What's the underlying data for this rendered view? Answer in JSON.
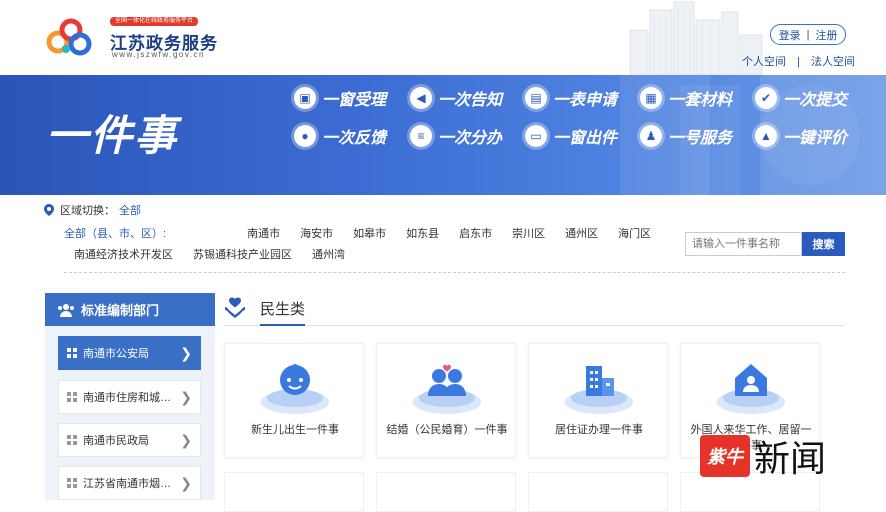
{
  "header": {
    "badge": "全国一体化在线政务服务平台",
    "title": "江苏政务服务",
    "url": "www.jszwfw.gov.cn",
    "login": "登录",
    "auth_sep": "|",
    "register": "注册",
    "personal_space": "个人空间",
    "space_sep": "|",
    "corporate_space": "法人空间"
  },
  "banner": {
    "title": "一件事",
    "features": [
      {
        "label": "一窗受理",
        "icon": "window-icon"
      },
      {
        "label": "一次告知",
        "icon": "megaphone-icon"
      },
      {
        "label": "一表申请",
        "icon": "form-icon"
      },
      {
        "label": "一套材料",
        "icon": "folder-icon"
      },
      {
        "label": "一次提交",
        "icon": "check-icon"
      },
      {
        "label": "一次反馈",
        "icon": "chat-icon"
      },
      {
        "label": "一次分办",
        "icon": "list-icon"
      },
      {
        "label": "一窗出件",
        "icon": "printer-icon"
      },
      {
        "label": "一号服务",
        "icon": "user-badge-icon"
      },
      {
        "label": "一键评价",
        "icon": "thumbs-up-icon"
      }
    ]
  },
  "region": {
    "label": "区域切换：",
    "current": "全部",
    "all_label": "全部（县、市、区）:",
    "cities": [
      "南通市",
      "海安市",
      "如皋市",
      "如东县",
      "启东市",
      "崇川区",
      "通州区",
      "海门区",
      "南通经济技术开发区",
      "苏锡通科技产业园区",
      "通州湾"
    ]
  },
  "search": {
    "placeholder": "请输入一件事名称",
    "button": "搜索"
  },
  "sidebar": {
    "title": "标准编制部门",
    "items": [
      {
        "label": "南通市公安局",
        "active": true
      },
      {
        "label": "南通市住房和城乡建设局",
        "active": false
      },
      {
        "label": "南通市民政局",
        "active": false
      },
      {
        "label": "江苏省南通市烟草专卖局",
        "active": false
      }
    ]
  },
  "category": {
    "title": "民生类",
    "cards": [
      {
        "label": "新生儿出生一件事",
        "icon": "baby-icon"
      },
      {
        "label": "结婚（公民婚育）一件事",
        "icon": "couple-icon"
      },
      {
        "label": "居住证办理一件事",
        "icon": "building-icon"
      },
      {
        "label": "外国人来华工作、居留一件事",
        "icon": "house-user-icon"
      }
    ]
  },
  "watermark": {
    "logo_text": "紫牛",
    "text": "新闻"
  },
  "colors": {
    "brand_blue": "#2a5bbd",
    "banner_blue": "#3c6cd3",
    "accent_red": "#e03a2c"
  }
}
